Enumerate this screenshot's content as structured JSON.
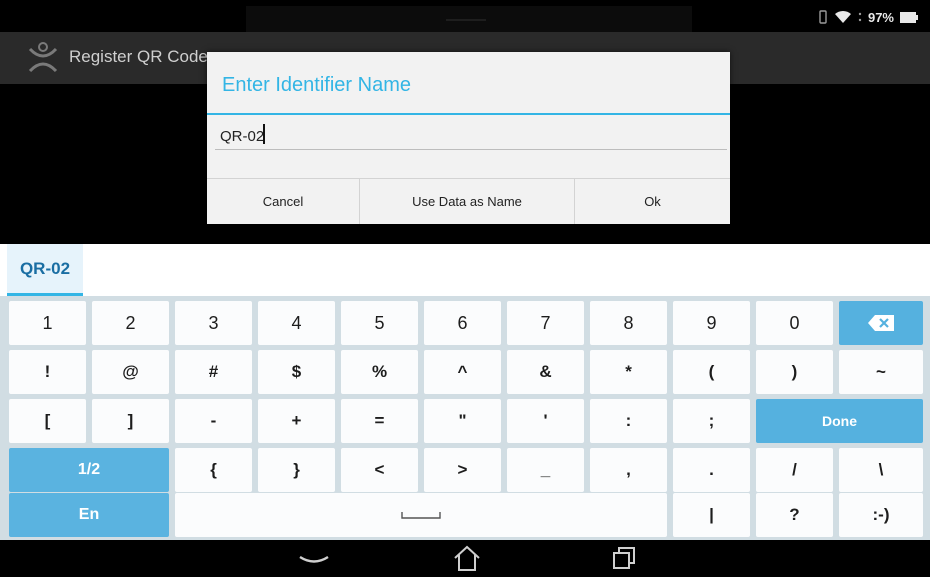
{
  "status_bar": {
    "battery_text": "97%",
    "icons": [
      "vibrate-icon",
      "wifi-icon",
      "signal-icon",
      "battery-icon"
    ]
  },
  "action_bar": {
    "title": "Register QR Code",
    "icon": "app-logo-icon"
  },
  "dialog": {
    "title": "Enter Identifier Name",
    "input_value": "QR-02",
    "buttons": {
      "cancel": "Cancel",
      "use_data": "Use Data as Name",
      "ok": "Ok"
    }
  },
  "suggestion": "QR-02",
  "keyboard": {
    "row1": [
      "1",
      "2",
      "3",
      "4",
      "5",
      "6",
      "7",
      "8",
      "9",
      "0"
    ],
    "row2": [
      "!",
      "@",
      "#",
      "$",
      "%",
      "^",
      "&",
      "*",
      "(",
      ")",
      "~"
    ],
    "row3": [
      "[",
      "]",
      "-",
      "+",
      "=",
      "\"",
      "'",
      ":",
      ";"
    ],
    "done": "Done",
    "row4_toggle": "1/2",
    "row4": [
      "{",
      "}",
      "<",
      ">",
      "_",
      ",",
      ".",
      "/",
      "\\"
    ],
    "lang": "En",
    "row5": [
      "|",
      "?",
      ":-)"
    ],
    "icons": [
      "backspace-icon",
      "space-icon"
    ]
  },
  "colors": {
    "accent": "#33b5e5",
    "key_blue": "#55b1df",
    "keyboard_bg": "#d1dde3",
    "actionbar_bg": "#2a2a2a"
  },
  "nav_bar": {
    "icons": [
      "back-icon",
      "home-icon",
      "recents-icon"
    ]
  }
}
